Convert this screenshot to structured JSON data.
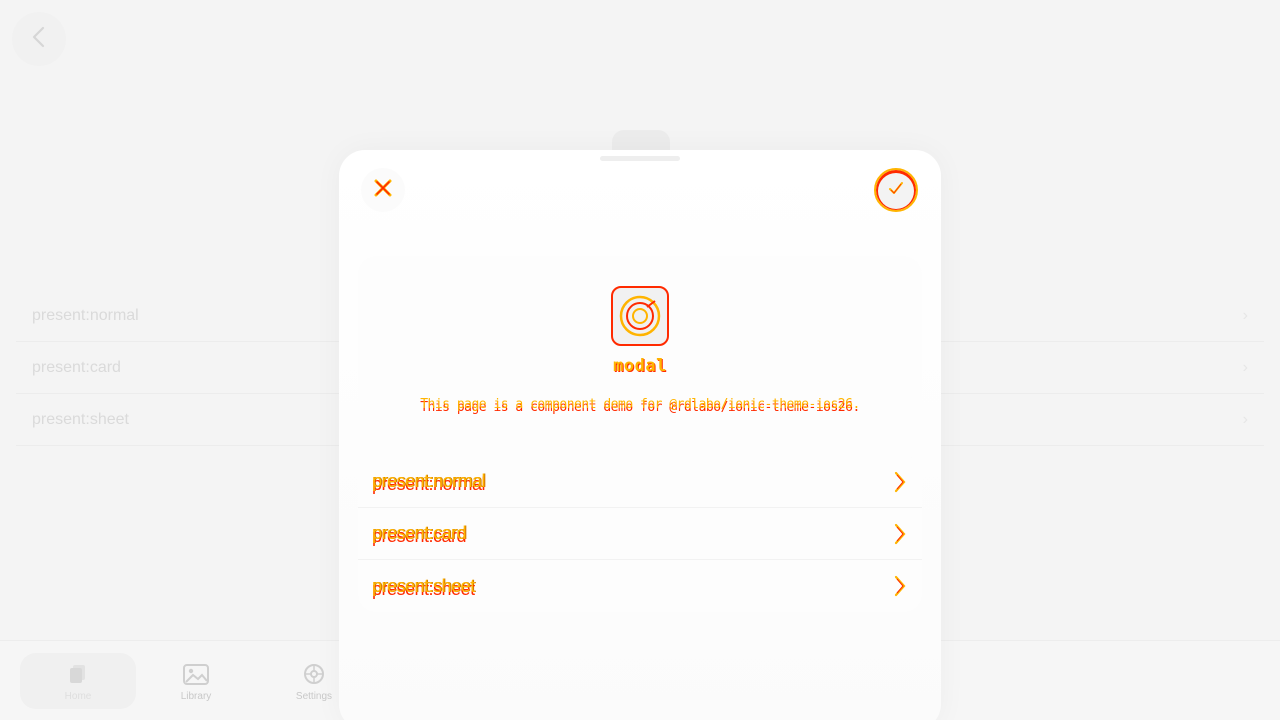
{
  "background": {
    "list": [
      {
        "label": "present:normal"
      },
      {
        "label": "present:card"
      },
      {
        "label": "present:sheet"
      }
    ],
    "tabs": [
      {
        "label": "Home",
        "icon": "documents-icon",
        "active": true
      },
      {
        "label": "Library",
        "icon": "image-icon",
        "active": false
      },
      {
        "label": "Settings",
        "icon": "gear-icon",
        "active": false
      }
    ]
  },
  "modal": {
    "title": "modal",
    "description": "This page is a component demo for @rdlabo/ionic-theme-ios26.",
    "items": [
      {
        "label": "present:normal"
      },
      {
        "label": "present:card"
      },
      {
        "label": "present:sheet"
      }
    ],
    "accent_yellow": "#ffb400",
    "accent_red": "#ff2a00"
  }
}
